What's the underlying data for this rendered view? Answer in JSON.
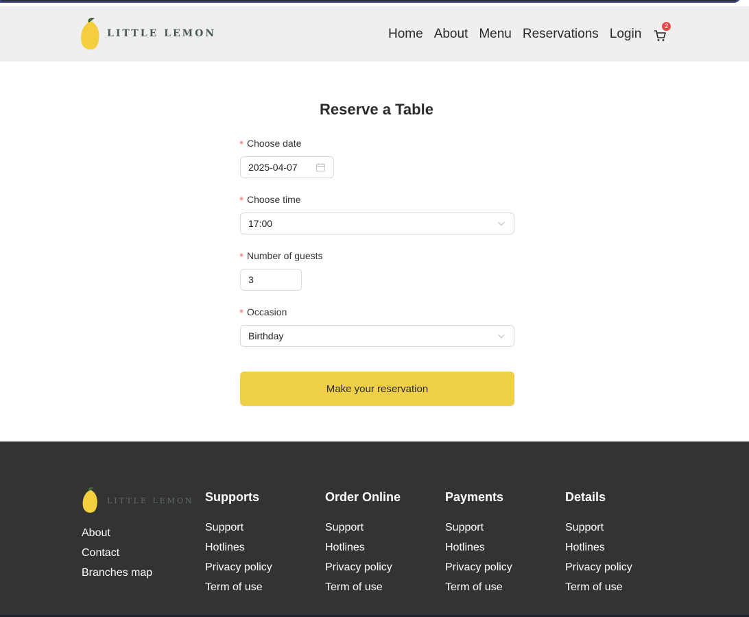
{
  "header": {
    "logo_text": "LITTLE LEMON",
    "nav": [
      "Home",
      "About",
      "Menu",
      "Reservations",
      "Login"
    ],
    "cart_count": "2"
  },
  "form": {
    "title": "Reserve a Table",
    "required_mark": "*",
    "date_label": "Choose date",
    "date_value": "2025-04-07",
    "time_label": "Choose time",
    "time_value": "17:00",
    "guests_label": "Number of guests",
    "guests_value": "3",
    "occasion_label": "Occasion",
    "occasion_value": "Birthday",
    "submit_label": "Make your reservation"
  },
  "footer": {
    "logo_text": "LITTLE LEMON",
    "links": [
      "About",
      "Contact",
      "Branches map"
    ],
    "columns": [
      {
        "title": "Supports",
        "items": [
          "Support",
          "Hotlines",
          "Privacy policy",
          "Term of use"
        ]
      },
      {
        "title": "Order Online",
        "items": [
          "Support",
          "Hotlines",
          "Privacy policy",
          "Term of use"
        ]
      },
      {
        "title": "Payments",
        "items": [
          "Support",
          "Hotlines",
          "Privacy policy",
          "Term of use"
        ]
      },
      {
        "title": "Details",
        "items": [
          "Support",
          "Hotlines",
          "Privacy policy",
          "Term of use"
        ]
      }
    ]
  },
  "colors": {
    "accent": "#f0cf48",
    "header_bg": "#efefef",
    "footer_bg": "#333333",
    "badge": "#e8484a"
  }
}
